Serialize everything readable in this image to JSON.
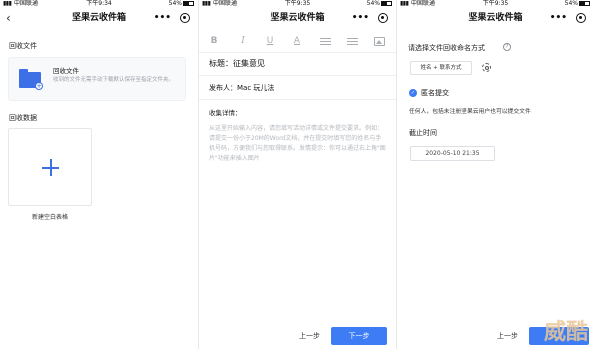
{
  "status_bars": [
    {
      "carrier": "中国联通",
      "time": "下午9:34",
      "battery": "54%"
    },
    {
      "carrier": "中国联通",
      "time": "下午9:35",
      "battery": "54%"
    },
    {
      "carrier": "中国联通",
      "time": "下午9:35",
      "battery": "54%"
    }
  ],
  "nav": {
    "title": "坚果云收件箱",
    "back_glyph": "‹",
    "more_glyph": "•••"
  },
  "panel1": {
    "section_recycle_files": "回收文件",
    "card": {
      "title": "回收文件",
      "description": "收到的文件无需手动下载默认保存至指定文件夹。"
    },
    "section_recycle_data": "回收数据",
    "new_form_label": "新建空白表格"
  },
  "panel2": {
    "toolbar": {
      "bold": "B",
      "italic": "I",
      "underline": "U",
      "color": "A"
    },
    "subject": "标题：征集意见",
    "sender": "发布人：Mac 玩儿法",
    "details_label": "收集详情：",
    "details_body": "从这里开始输入内容，请您填写活动详情或文件提交要求。例如：请提交一份小于20M的Word文档，并在提交时填写您的姓名与手机号码，方便我们与您取得联系。发情提示：你可以通过右上角\"图片\"功能来插入图片",
    "prev_label": "上一步",
    "next_label": "下一步"
  },
  "panel3": {
    "naming_heading": "请选择文件回收命名方式",
    "help_glyph": "?",
    "naming_chip": "姓名 + 联系方式",
    "anonymous_label": "匿名提交",
    "anonymous_desc": "任何人，包括未注册坚果云用户也可以提交文件",
    "deadline_label": "截止时间",
    "deadline_value": "2020-05-10 21:35",
    "prev_label": "上一步",
    "check_glyph": "✓"
  },
  "watermark": "威酷",
  "colors": {
    "accent": "#3d7cf5",
    "folder": "#3d6fe6",
    "placeholder": "#b4b8bd"
  }
}
